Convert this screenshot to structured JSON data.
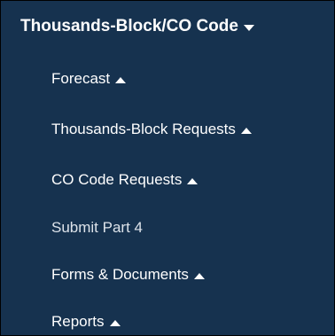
{
  "menu": {
    "header": {
      "label": "Thousands-Block/CO Code",
      "icon": "caret-down-icon"
    },
    "items": [
      {
        "label": "Forecast",
        "icon": "caret-up-icon"
      },
      {
        "label": "Thousands-Block Requests",
        "icon": "caret-up-icon"
      },
      {
        "label": "CO Code Requests",
        "icon": "caret-up-icon"
      },
      {
        "label": "Submit Part 4"
      },
      {
        "label": "Forms & Documents",
        "icon": "caret-up-icon"
      },
      {
        "label": "Reports",
        "icon": "caret-up-icon"
      }
    ]
  },
  "colors": {
    "background": "#16324f",
    "text": "#ffffff",
    "muted_text": "#dde3ea",
    "border": "#000000"
  }
}
